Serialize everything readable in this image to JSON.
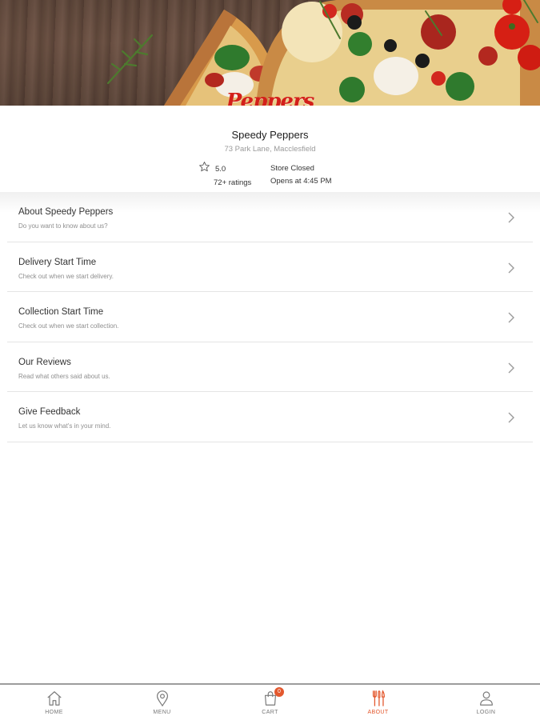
{
  "store": {
    "logo_text": "Peppers",
    "name": "Speedy Peppers",
    "address": "73 Park Lane, Macclesfield",
    "rating": "5.0",
    "ratings_count": "72+ ratings",
    "status": "Store Closed",
    "opens": "Opens at 4:45 PM"
  },
  "info_items": [
    {
      "title": "About Speedy Peppers",
      "subtitle": "Do you want to know about us?"
    },
    {
      "title": "Delivery Start Time",
      "subtitle": "Check out when we start delivery."
    },
    {
      "title": "Collection Start Time",
      "subtitle": "Check out when we start collection."
    },
    {
      "title": "Our Reviews",
      "subtitle": "Read what others said about us."
    },
    {
      "title": "Give Feedback",
      "subtitle": "Let us know what's in your mind."
    }
  ],
  "tabs": {
    "home": "HOME",
    "menu": "MENU",
    "cart": "CART",
    "cart_count": "0",
    "about": "ABOUT",
    "login": "LOGIN"
  },
  "icons": {
    "rating": "star-icon",
    "row_arrow": "chevron-right-icon",
    "home": "home-icon",
    "menu": "location-pin-icon",
    "cart": "shopping-bag-icon",
    "about": "utensils-icon",
    "login": "user-icon"
  },
  "colors": {
    "accent": "#e3582e",
    "logo_red": "#d3201a",
    "divider": "#e4e4e4"
  }
}
